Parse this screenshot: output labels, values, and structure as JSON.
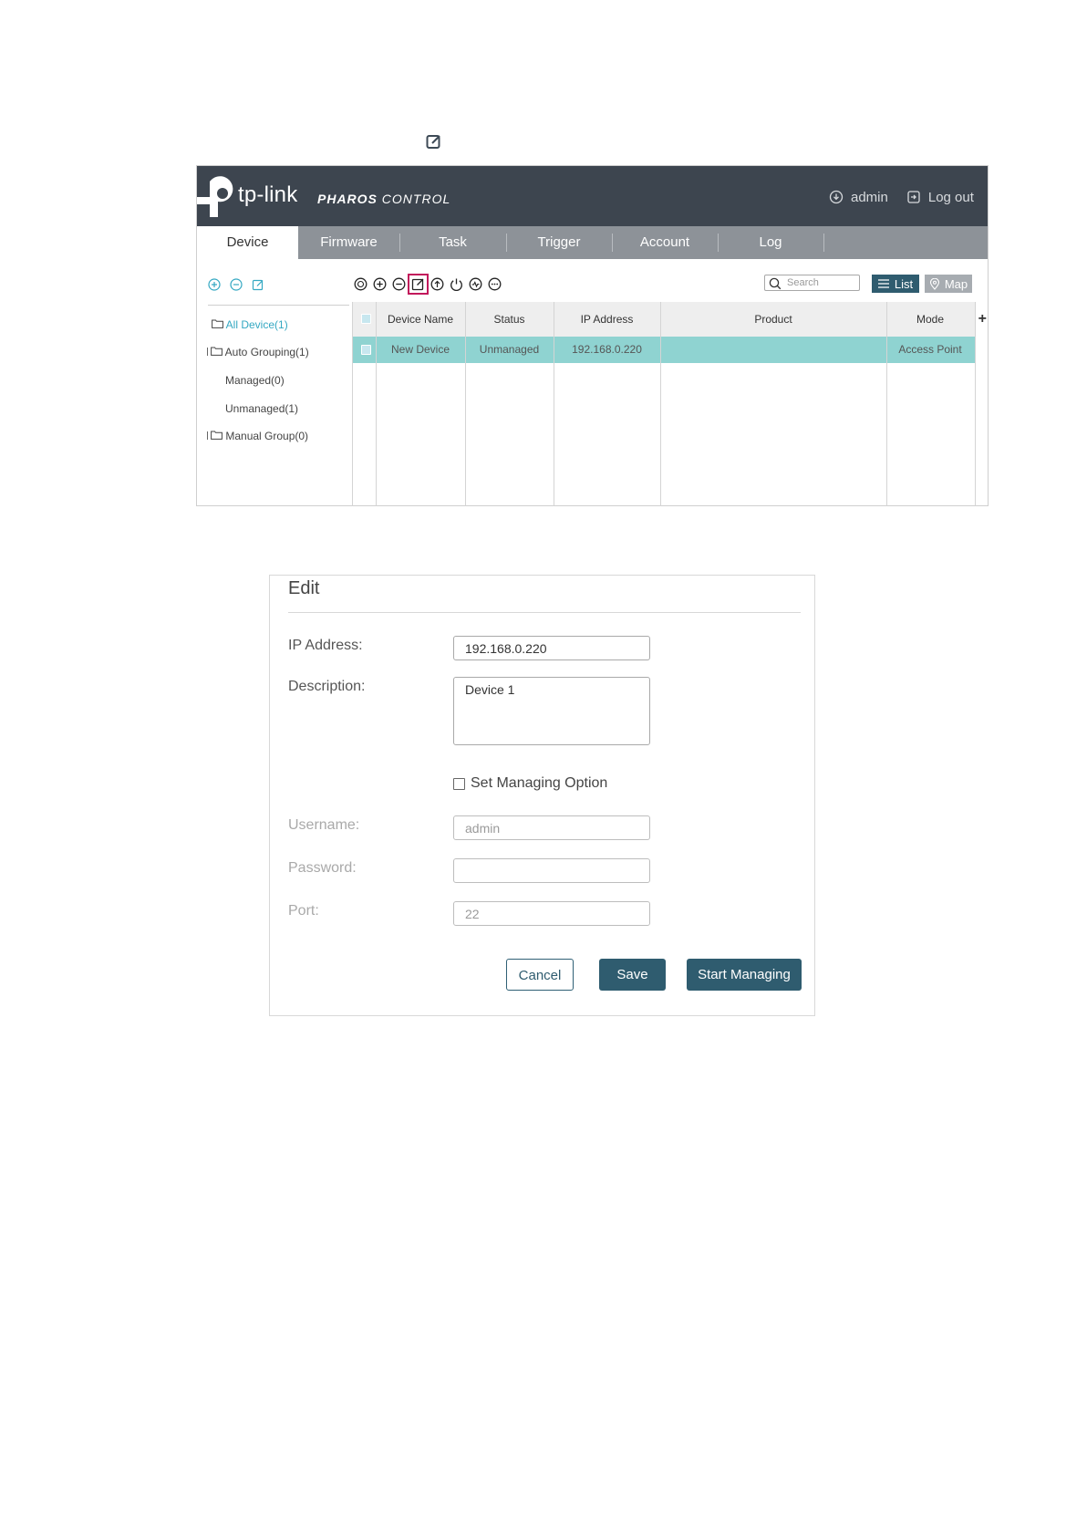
{
  "app": {
    "logo_text": "tp-link",
    "product_name_bold": "PHAROS",
    "product_name_rest": " CONTROL",
    "user": "admin",
    "logout_label": "Log out",
    "tabs": [
      {
        "label": "Device",
        "active": true
      },
      {
        "label": "Firmware",
        "active": false
      },
      {
        "label": "Task",
        "active": false
      },
      {
        "label": "Trigger",
        "active": false
      },
      {
        "label": "Account",
        "active": false
      },
      {
        "label": "Log",
        "active": false
      }
    ],
    "sidebar": {
      "tools": [
        "add-group-icon",
        "remove-group-icon",
        "edit-group-icon"
      ],
      "tree": [
        {
          "label": "All Device(1)",
          "active": true
        },
        {
          "label": "Auto Grouping(1)"
        },
        {
          "label": "Managed(0)"
        },
        {
          "label": "Unmanaged(1)"
        },
        {
          "label": "Manual Group(0)"
        }
      ]
    },
    "grid": {
      "tools": [
        "refresh-icon",
        "add-icon",
        "remove-icon",
        "edit-icon",
        "upgrade-icon",
        "reboot-icon",
        "speed-icon",
        "more-icon"
      ],
      "search_placeholder": "Search",
      "list_label": "List",
      "map_label": "Map",
      "columns": [
        "Device Name",
        "Status",
        "IP Address",
        "Product",
        "Mode"
      ],
      "rows": [
        {
          "device_name": "New Device",
          "status": "Unmanaged",
          "ip": "192.168.0.220",
          "product": "",
          "mode": "Access Point"
        }
      ]
    }
  },
  "dialog": {
    "title": "Edit",
    "ip_label": "IP Address:",
    "ip_value": "192.168.0.220",
    "desc_label": "Description:",
    "desc_value": "Device 1",
    "managing_option": "Set Managing Option",
    "username_label": "Username:",
    "username_value": "admin",
    "password_label": "Password:",
    "password_value": "",
    "port_label": "Port:",
    "port_value": "22",
    "cancel": "Cancel",
    "save": "Save",
    "start_managing": "Start Managing"
  },
  "colors": {
    "header_bg": "#3d454f",
    "tabbar_bg": "#8d9298",
    "selected_row": "#8fd3d1",
    "accent_button": "#2f5c6f",
    "active_tree": "#34a8c2",
    "highlight_box": "#c2185b"
  }
}
